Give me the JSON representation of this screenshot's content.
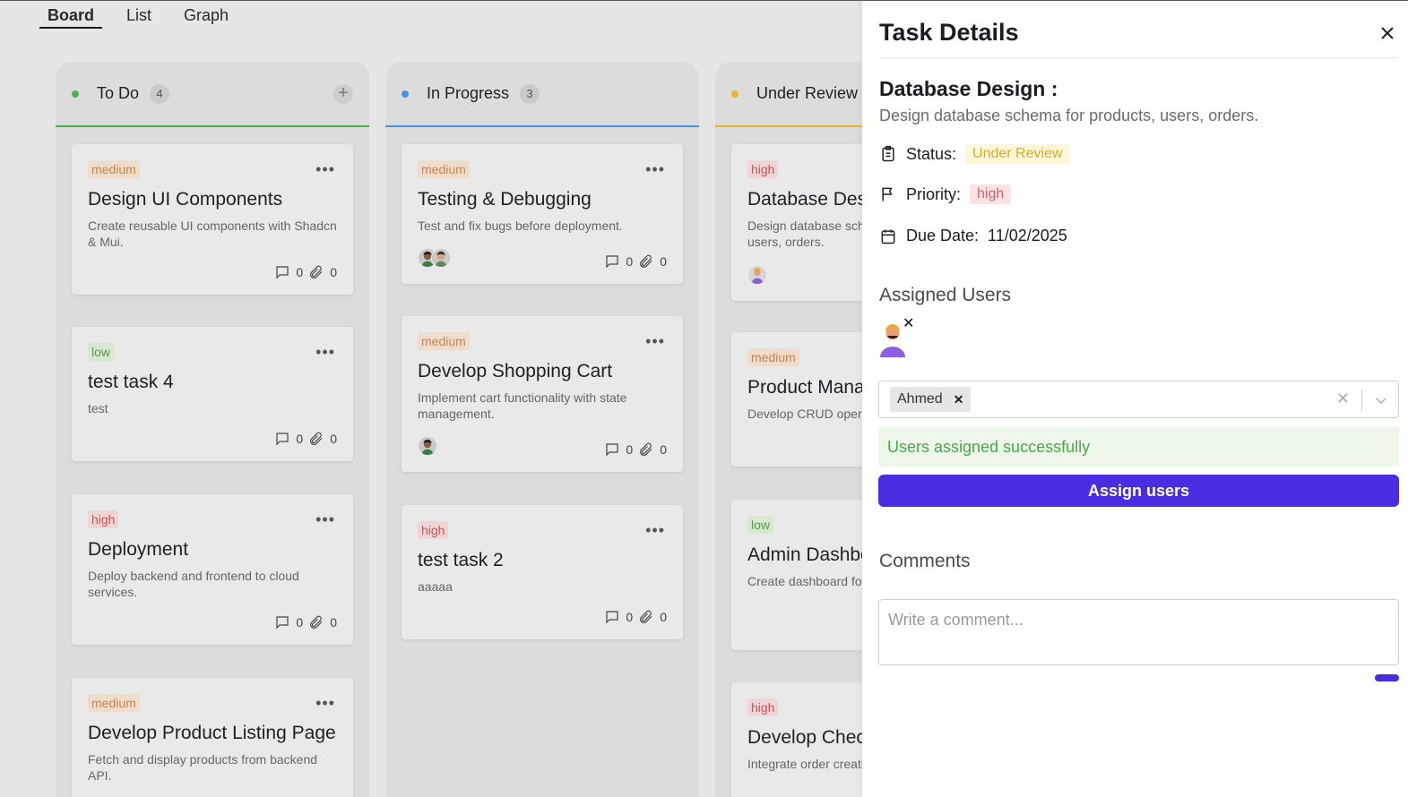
{
  "tabs": [
    "Board",
    "List",
    "Graph"
  ],
  "columns": [
    {
      "title": "To Do",
      "count": "4",
      "color": "#4caf50",
      "cards": [
        {
          "priority": "medium",
          "title": "Design UI Components",
          "desc": "Create reusable UI components with Shadcn & Mui.",
          "comments": "0",
          "attachments": "0"
        },
        {
          "priority": "low",
          "title": "test task 4",
          "desc": "test",
          "comments": "0",
          "attachments": "0"
        },
        {
          "priority": "high",
          "title": "Deployment",
          "desc": "Deploy backend and frontend to cloud services.",
          "comments": "0",
          "attachments": "0"
        },
        {
          "priority": "medium",
          "title": "Develop Product Listing Page",
          "desc": "Fetch and display products from backend API."
        }
      ]
    },
    {
      "title": "In Progress",
      "count": "3",
      "color": "#4a90e2",
      "cards": [
        {
          "priority": "medium",
          "title": "Testing & Debugging",
          "desc": "Test and fix bugs before deployment.",
          "comments": "0",
          "attachments": "0"
        },
        {
          "priority": "medium",
          "title": "Develop Shopping Cart",
          "desc": "Implement cart functionality with state management.",
          "comments": "0",
          "attachments": "0"
        },
        {
          "priority": "high",
          "title": "test task 2",
          "desc": "aaaaa",
          "comments": "0",
          "attachments": "0"
        }
      ]
    },
    {
      "title": "Under Review",
      "color": "#e5b62a",
      "cards": [
        {
          "priority": "high",
          "title": "Database Design :",
          "desc": "Design database schema for products, users, orders."
        },
        {
          "priority": "medium",
          "title": "Product Management",
          "desc": "Develop CRUD operations"
        },
        {
          "priority": "low",
          "title": "Admin Dashboard",
          "desc": "Create dashboard for orders, products."
        },
        {
          "priority": "high",
          "title": "Develop Checkout",
          "desc": "Integrate order creation and payments."
        }
      ]
    }
  ],
  "panel": {
    "title": "Task Details",
    "task_title": "Database Design :",
    "task_desc": "Design database schema for products, users, orders.",
    "status_label": "Status:",
    "status_value": "Under Review",
    "priority_label": "Priority:",
    "priority_value": "high",
    "due_label": "Due Date:",
    "due_value": "11/02/2025",
    "assigned_heading": "Assigned Users",
    "selected_user": "Ahmed",
    "success_message": "Users assigned successfully",
    "assign_button": "Assign users",
    "comments_heading": "Comments",
    "comment_placeholder": "Write a comment..."
  },
  "colors": {
    "accent": "#4a2de0",
    "todo": "#4caf50",
    "in_progress": "#4a90e2",
    "under_review": "#e5b62a"
  },
  "icons": [
    "comment-icon",
    "paperclip-icon",
    "close-icon",
    "clipboard-icon",
    "flag-icon",
    "calendar-icon",
    "chevron-down-icon",
    "plus-icon",
    "more-horizontal-icon"
  ]
}
